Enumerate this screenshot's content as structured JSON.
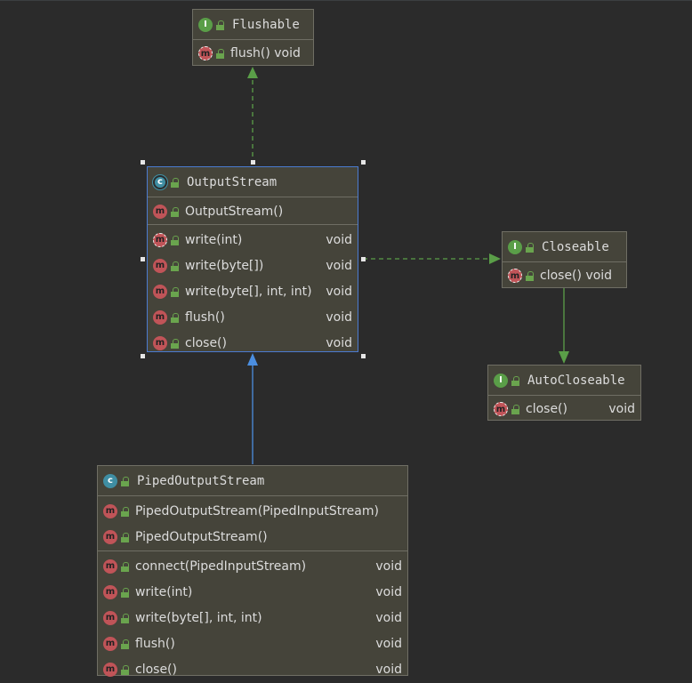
{
  "colors": {
    "background": "#2b2b2b",
    "node_fill": "#45443a",
    "implements_edge": "#5a9e48",
    "extends_edge": "#4b8ee0",
    "selection": "#4b7bd0"
  },
  "icons": {
    "interface": "I",
    "class": "c",
    "method": "m",
    "visibility": "lock-icon"
  },
  "nodes": {
    "flushable": {
      "name": "Flushable",
      "kind": "interface",
      "methods": [
        {
          "name": "flush()",
          "type": "void"
        }
      ]
    },
    "output_stream": {
      "name": "OutputStream",
      "kind": "class",
      "constructors": [
        {
          "name": "OutputStream()"
        }
      ],
      "methods": [
        {
          "name": "write(int)",
          "type": "void"
        },
        {
          "name": "write(byte[])",
          "type": "void"
        },
        {
          "name": "write(byte[], int, int)",
          "type": "void"
        },
        {
          "name": "flush()",
          "type": "void"
        },
        {
          "name": "close()",
          "type": "void"
        }
      ]
    },
    "closeable": {
      "name": "Closeable",
      "kind": "interface",
      "methods": [
        {
          "name": "close()",
          "type": "void"
        }
      ]
    },
    "auto_closeable": {
      "name": "AutoCloseable",
      "kind": "interface",
      "methods": [
        {
          "name": "close()",
          "type": "void"
        }
      ]
    },
    "piped_output_stream": {
      "name": "PipedOutputStream",
      "kind": "class",
      "constructors": [
        {
          "name": "PipedOutputStream(PipedInputStream)"
        },
        {
          "name": "PipedOutputStream()"
        }
      ],
      "methods": [
        {
          "name": "connect(PipedInputStream)",
          "type": "void"
        },
        {
          "name": "write(int)",
          "type": "void"
        },
        {
          "name": "write(byte[], int, int)",
          "type": "void"
        },
        {
          "name": "flush()",
          "type": "void"
        },
        {
          "name": "close()",
          "type": "void"
        }
      ]
    }
  }
}
